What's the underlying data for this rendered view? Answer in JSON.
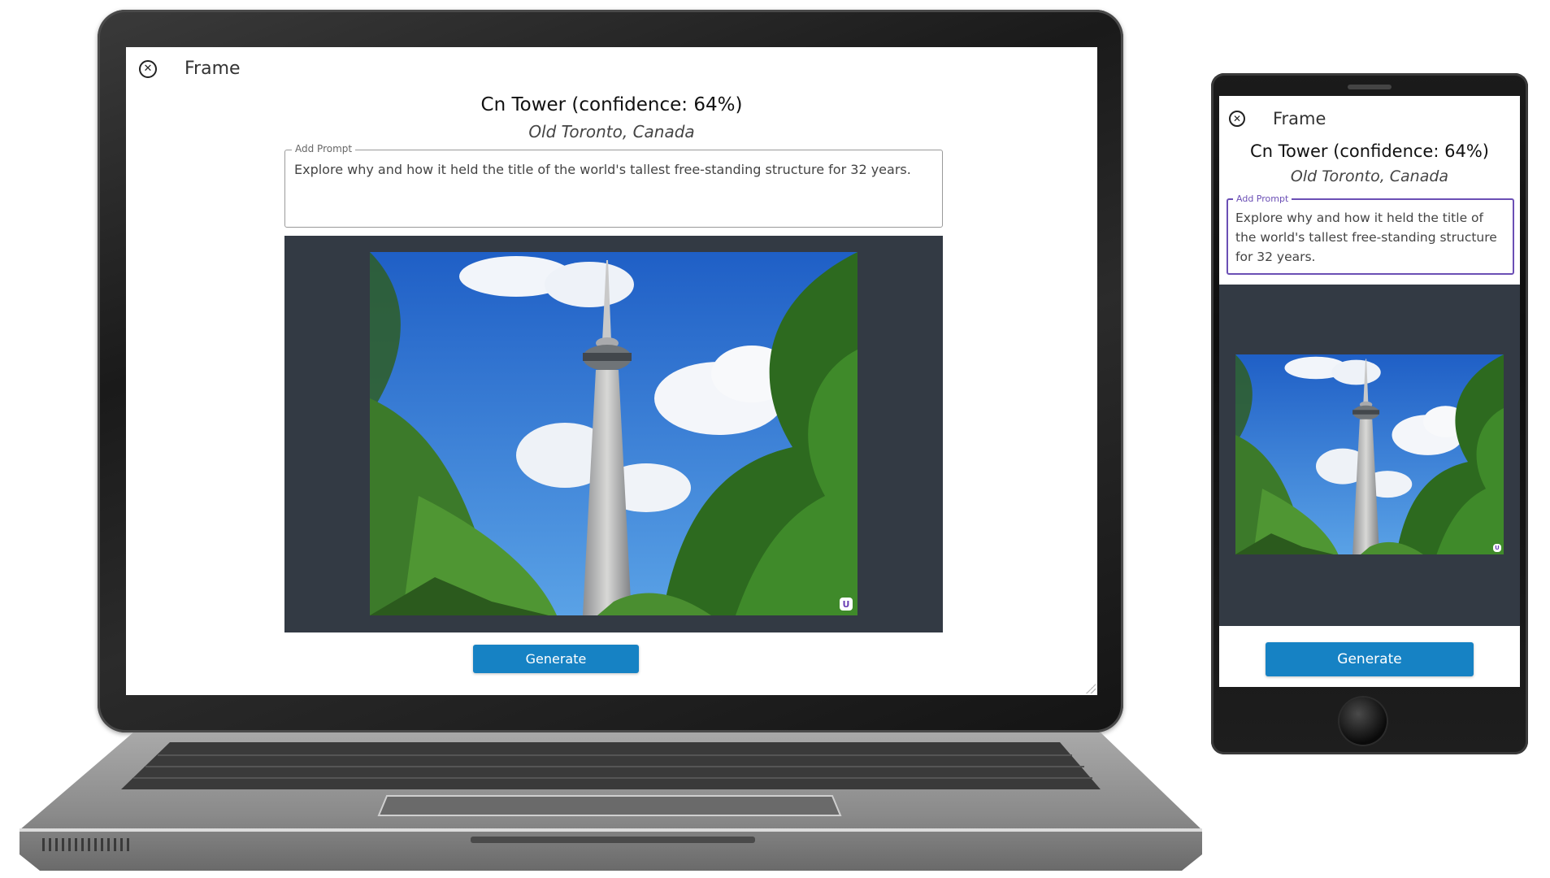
{
  "laptop": {
    "frame_label": "Frame",
    "title": "Cn Tower (confidence: 64%)",
    "subtitle": "Old Toronto, Canada",
    "prompt_legend": "Add Prompt",
    "prompt_text": "Explore why and how it held the title of the world's tallest free-standing structure for 32 years.",
    "generate_label": "Generate"
  },
  "phone": {
    "frame_label": "Frame",
    "title": "Cn Tower (confidence: 64%)",
    "subtitle": "Old Toronto, Canada",
    "prompt_legend": "Add Prompt",
    "prompt_text": "Explore why and how it held the title of the world's tallest free-standing structure for 32 years.",
    "generate_label": "Generate"
  },
  "icons": {
    "close": "close-circle-icon",
    "badge": "badge-icon"
  },
  "colors": {
    "generate_button": "#1682c4",
    "image_panel": "#333a44",
    "prompt_focus_border": "#6b4fb5"
  }
}
